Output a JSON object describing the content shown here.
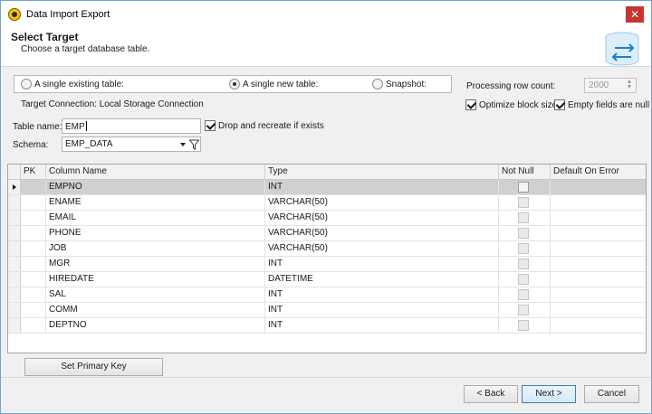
{
  "window": {
    "title": "Data Import Export"
  },
  "header": {
    "title": "Select Target",
    "subtitle": "Choose a target database table."
  },
  "target_mode": {
    "options": [
      {
        "label": "A single existing table:",
        "checked": false
      },
      {
        "label": "A single new table:",
        "checked": true
      },
      {
        "label": "Snapshot:",
        "checked": false
      }
    ],
    "connection": "Target Connection: Local Storage Connection"
  },
  "processing": {
    "label": "Processing row count:",
    "value": "2000",
    "optimize_label": "Optimize block size",
    "optimize_checked": true,
    "empty_null_label": "Empty fields are null",
    "empty_null_checked": true
  },
  "table": {
    "label": "Table name:",
    "value": "EMP",
    "drop_label": "Drop and recreate if exists",
    "drop_checked": true
  },
  "schema": {
    "label": "Schema:",
    "value": "EMP_DATA"
  },
  "grid": {
    "columns": [
      "PK",
      "Column Name",
      "Type",
      "Not Null",
      "Default On Error"
    ],
    "rows": [
      {
        "name": "EMPNO",
        "type": "INT",
        "selected": true
      },
      {
        "name": "ENAME",
        "type": "VARCHAR(50)"
      },
      {
        "name": "EMAIL",
        "type": "VARCHAR(50)"
      },
      {
        "name": "PHONE",
        "type": "VARCHAR(50)"
      },
      {
        "name": "JOB",
        "type": "VARCHAR(50)"
      },
      {
        "name": "MGR",
        "type": "INT"
      },
      {
        "name": "HIREDATE",
        "type": "DATETIME"
      },
      {
        "name": "SAL",
        "type": "INT"
      },
      {
        "name": "COMM",
        "type": "INT"
      },
      {
        "name": "DEPTNO",
        "type": "INT"
      }
    ]
  },
  "buttons": {
    "set_pk": "Set Primary Key",
    "back": "< Back",
    "next": "Next >",
    "cancel": "Cancel"
  },
  "colors": {
    "accent": "#1e7fd0",
    "close": "#c7362e",
    "selected_row": "#d0d0d0"
  },
  "icons": [
    "app-logo-icon",
    "close-icon",
    "database-transfer-icon",
    "dropdown-arrow-icon",
    "filter-icon",
    "row-pointer-icon"
  ]
}
